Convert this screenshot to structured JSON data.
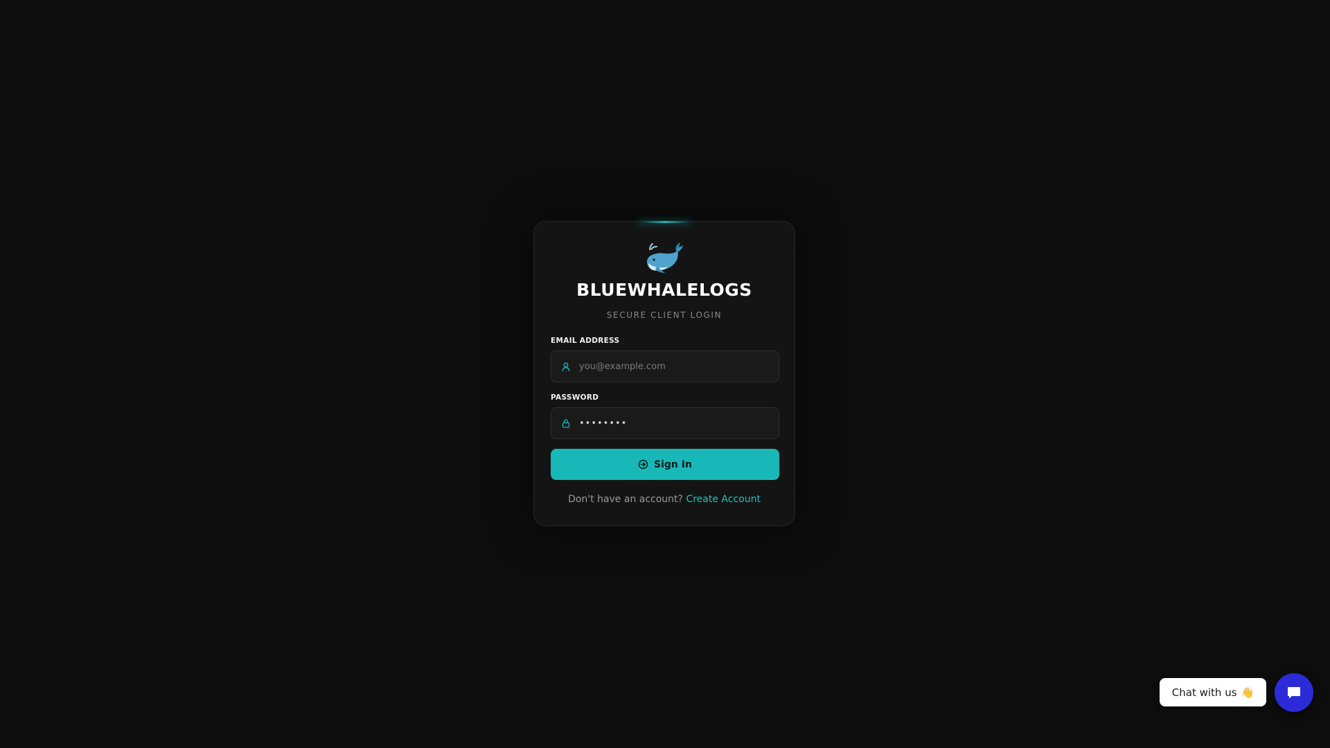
{
  "login": {
    "logo_emoji": "🐋",
    "title": "BLUEWHALELOGS",
    "subtitle": "SECURE CLIENT LOGIN",
    "email_label": "EMAIL ADDRESS",
    "email_placeholder": "you@example.com",
    "password_label": "PASSWORD",
    "password_value": "••••••••",
    "signin_label": "Sign In",
    "no_account_text": "Don't have an account? ",
    "create_account_link": "Create Account"
  },
  "chat": {
    "label": "Chat with us",
    "wave_emoji": "👋"
  },
  "colors": {
    "background": "#0d0d0d",
    "card": "#141414",
    "accent": "#18b8b8",
    "chat_button": "#2b2bd8"
  },
  "icons": {
    "email": "user-icon",
    "password": "lock-icon",
    "signin": "sign-in-icon",
    "chat": "chat-bubble-icon"
  }
}
